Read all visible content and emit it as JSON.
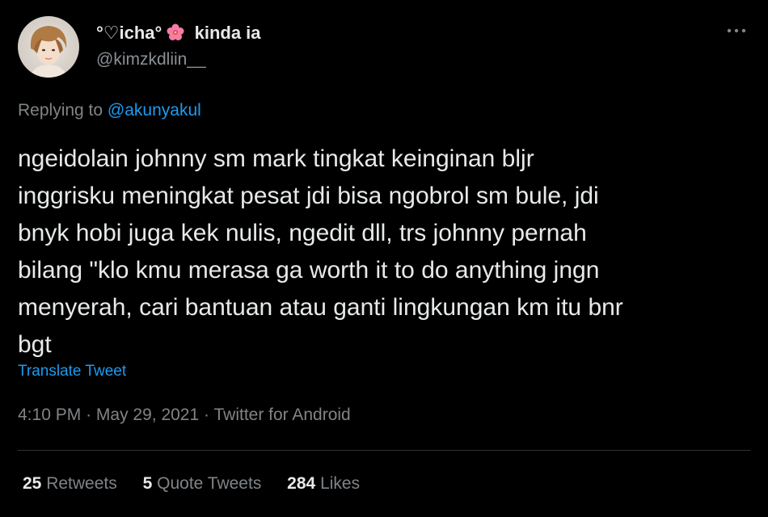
{
  "user": {
    "display_name_prefix": "°♡icha°",
    "display_name_suffix": "kinda ia",
    "flower_icon": "hibiscus-emoji",
    "handle": "@kimzkdliin__"
  },
  "reply": {
    "prefix": "Replying to",
    "mention": "@akunyakul"
  },
  "tweet": {
    "text": "ngeidolain johnny sm mark tingkat keinginan bljr\ninggrisku meningkat pesat jdi bisa ngobrol sm bule, jdi\nbnyk hobi juga kek nulis, ngedit dll, trs johnny pernah\nbilang \"klo kmu merasa ga worth it to do anything jngn\nmenyerah, cari bantuan atau ganti lingkungan km itu bnr\nbgt",
    "translate_label": "Translate Tweet",
    "time": "4:10 PM",
    "date": "May 29, 2021",
    "source": "Twitter for Android",
    "separator": "·"
  },
  "stats": {
    "retweets_count": "25",
    "retweets_label": "Retweets",
    "quotes_count": "5",
    "quotes_label": "Quote Tweets",
    "likes_count": "284",
    "likes_label": "Likes"
  },
  "colors": {
    "background": "#000000",
    "text_primary": "#e7e9ea",
    "text_secondary": "#808487",
    "link": "#1d9bf0"
  }
}
